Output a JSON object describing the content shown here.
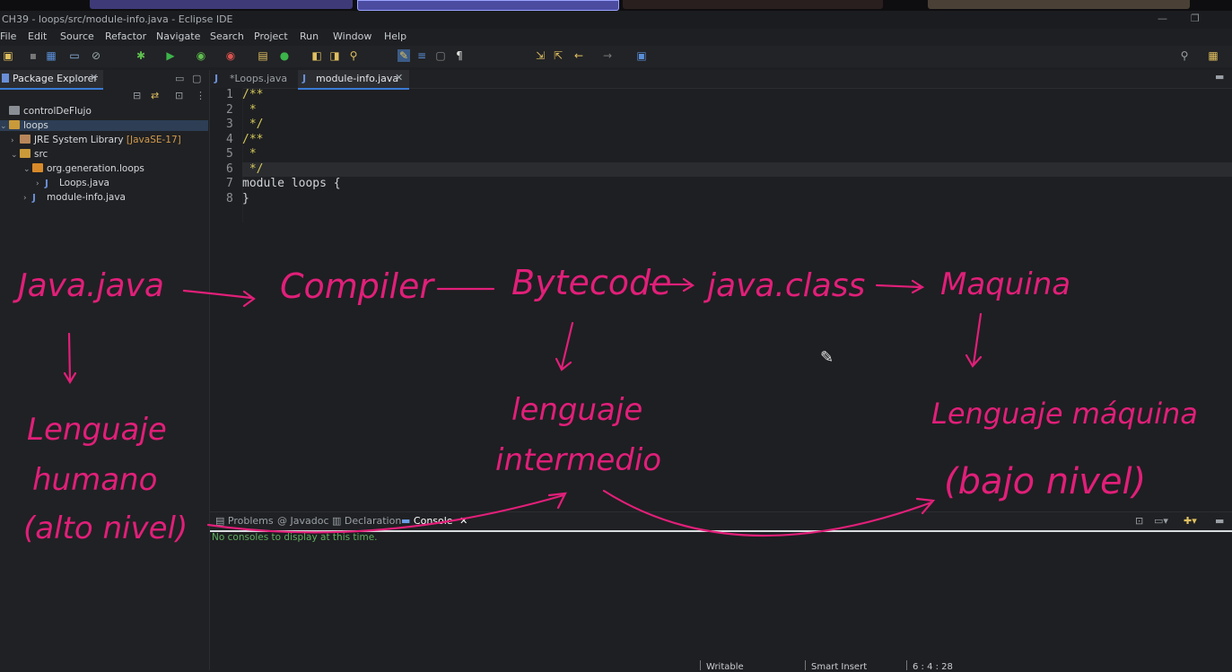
{
  "window": {
    "title": "CH39 - loops/src/module-info.java - Eclipse IDE"
  },
  "menu": [
    "File",
    "Edit",
    "Source",
    "Refactor",
    "Navigate",
    "Search",
    "Project",
    "Run",
    "Window",
    "Help"
  ],
  "package_explorer": {
    "tab_label": "Package Explorer",
    "tree": [
      {
        "label": "controlDeFlujo"
      },
      {
        "label": "loops"
      },
      {
        "label": "JRE System Library",
        "decoration": "[JavaSE-17]"
      },
      {
        "label": "src"
      },
      {
        "label": "org.generation.loops"
      },
      {
        "label": "Loops.java"
      },
      {
        "label": "module-info.java"
      }
    ]
  },
  "editor": {
    "tabs": [
      {
        "label": "*Loops.java"
      },
      {
        "label": "module-info.java"
      }
    ],
    "lines": [
      {
        "num": "1",
        "text": "/**"
      },
      {
        "num": "2",
        "text": " *"
      },
      {
        "num": "3",
        "text": " */"
      },
      {
        "num": "4",
        "text": "/**"
      },
      {
        "num": "5",
        "text": " *"
      },
      {
        "num": "6",
        "text": " */"
      },
      {
        "num": "7",
        "text": "module loops {"
      },
      {
        "num": "8",
        "text": "}"
      }
    ]
  },
  "bottom_panel": {
    "tabs": [
      {
        "label": "Problems"
      },
      {
        "label": "Javadoc"
      },
      {
        "label": "Declaration"
      },
      {
        "label": "Console"
      }
    ],
    "message": "No consoles to display at this time."
  },
  "status": {
    "writable": "Writable",
    "insert": "Smart Insert",
    "position": "6 : 4 : 28"
  },
  "annotations": {
    "java_file": "Java.java",
    "compiler": "Compiler",
    "bytecode": "Bytecode",
    "class_file": "java.class",
    "machine": "Maquina",
    "human_lang_1": "Lenguaje",
    "human_lang_2": "humano",
    "human_lang_3": "(alto nivel)",
    "inter_1": "lenguaje",
    "inter_2": "intermedio",
    "machine_lang_1": "Lenguaje máquina",
    "machine_lang_2": "(bajo nivel)"
  },
  "colors": {
    "ink": "#e11f79",
    "accent": "#3a7bd5",
    "comment": "#d3c85a"
  }
}
